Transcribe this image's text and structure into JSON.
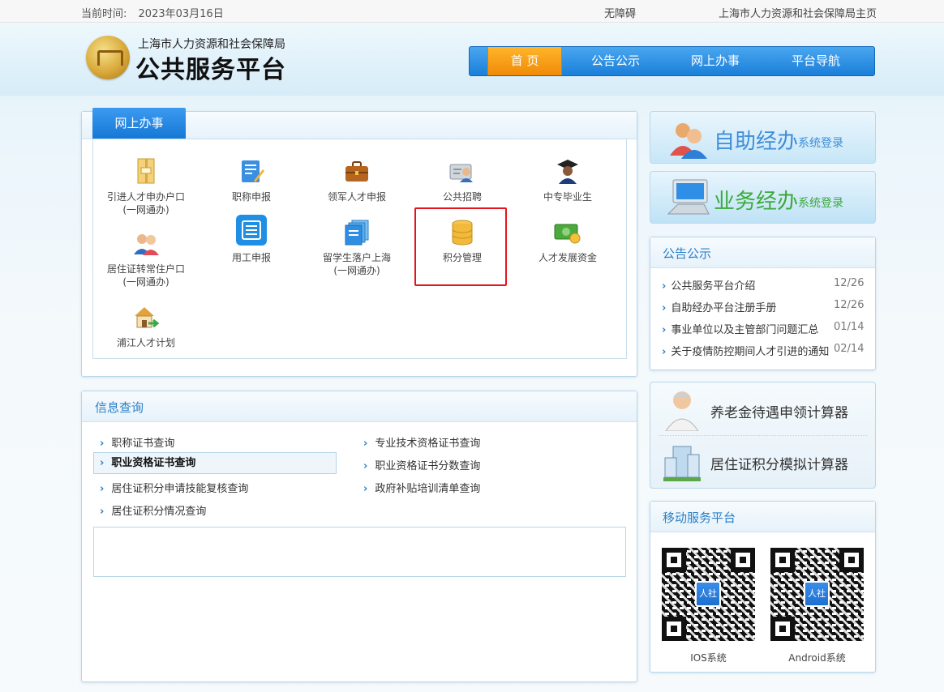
{
  "topbar": {
    "date_label": "当前时间:",
    "date_value": "2023年03月16日",
    "accessibility": "无障碍",
    "home_link": "上海市人力资源和社会保障局主页"
  },
  "header": {
    "org_name": "上海市人力资源和社会保障局",
    "platform_name": "公共服务平台",
    "nav": [
      "首 页",
      "公告公示",
      "网上办事",
      "平台导航"
    ]
  },
  "online_services": {
    "tab_label": "网上办事",
    "items": [
      {
        "label": "引进人才申办户口",
        "sub": "(一网通办)",
        "icon": "document-folder-icon"
      },
      {
        "label": "职称申报",
        "sub": "",
        "icon": "certificate-edit-icon"
      },
      {
        "label": "领军人才申报",
        "sub": "",
        "icon": "briefcase-icon"
      },
      {
        "label": "公共招聘",
        "sub": "",
        "icon": "id-card-person-icon"
      },
      {
        "label": "中专毕业生",
        "sub": "",
        "icon": "graduate-icon"
      },
      {
        "label": "居住证转常住户口",
        "sub": "(一网通办)",
        "icon": "couple-icon"
      },
      {
        "label": "用工申报",
        "sub": "",
        "icon": "list-document-icon"
      },
      {
        "label": "留学生落户上海",
        "sub": "(一网通办)",
        "icon": "stacked-documents-icon"
      },
      {
        "label": "积分管理",
        "sub": "",
        "icon": "database-icon"
      },
      {
        "label": "人才发展资金",
        "sub": "",
        "icon": "money-icon"
      },
      {
        "label": "浦江人才计划",
        "sub": "",
        "icon": "house-arrow-icon"
      }
    ]
  },
  "info_query": {
    "title": "信息查询",
    "left": [
      "职称证书查询",
      "职业资格证书查询",
      "居住证积分申请技能复核查询",
      "居住证积分情况查询"
    ],
    "right": [
      "专业技术资格证书查询",
      "职业资格证书分数查询",
      "政府补贴培训清单查询"
    ]
  },
  "banners": {
    "self_service": {
      "main": "自助经办",
      "sub": "系统登录"
    },
    "business": {
      "main": "业务经办",
      "sub": "系统登录"
    }
  },
  "notices": {
    "title": "公告公示",
    "items": [
      {
        "text": "公共服务平台介绍",
        "date": "12/26"
      },
      {
        "text": "自助经办平台注册手册",
        "date": "12/26"
      },
      {
        "text": "事业单位以及主管部门问题汇总",
        "date": "01/14"
      },
      {
        "text": "关于疫情防控期间人才引进的通知",
        "date": "02/14"
      }
    ]
  },
  "calculators": [
    "养老金待遇申领计算器",
    "居住证积分模拟计算器"
  ],
  "mobile": {
    "title": "移动服务平台",
    "qr_logo_text": "人社",
    "ios": "IOS系统",
    "android": "Android系统"
  },
  "colors": {
    "nav_blue": "#1a7fd9",
    "nav_active": "#f08a08",
    "highlight_red": "#e4151b",
    "title_blue": "#2a7fc6"
  }
}
